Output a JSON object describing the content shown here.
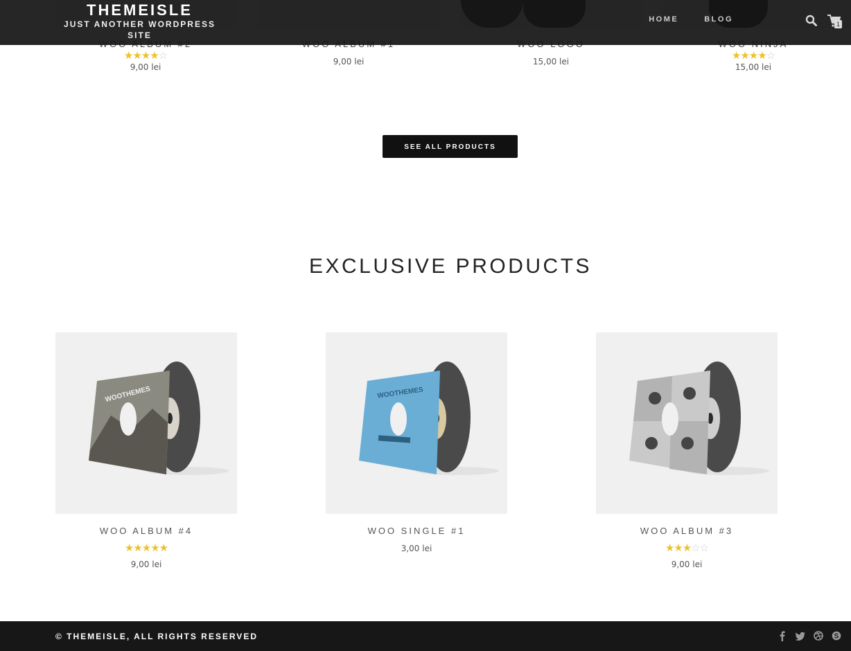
{
  "header": {
    "site_title": "THEMEISLE",
    "tagline": "JUST ANOTHER WORDPRESS SITE",
    "nav": [
      {
        "label": "HOME"
      },
      {
        "label": "BLOG"
      }
    ],
    "cart_count": "1"
  },
  "top_products": [
    {
      "name": "WOO ALBUM #2",
      "rating": 4,
      "price": "9,00 lei"
    },
    {
      "name": "WOO ALBUM #1",
      "rating": 0,
      "price": "9,00 lei"
    },
    {
      "name": "WOO LOGO",
      "rating": 0,
      "price": "15,00 lei"
    },
    {
      "name": "WOO NINJA",
      "rating": 4,
      "price": "15,00 lei"
    }
  ],
  "see_all_button": "SEE ALL PRODUCTS",
  "exclusive": {
    "title": "EXCLUSIVE PRODUCTS",
    "products": [
      {
        "name": "WOO ALBUM #4",
        "rating": 5,
        "price": "9,00 lei",
        "cover_text": "WOOTHEMES"
      },
      {
        "name": "WOO SINGLE #1",
        "rating": 0,
        "price": "3,00 lei",
        "cover_text": "WOOTHEMES"
      },
      {
        "name": "WOO ALBUM #3",
        "rating": 3,
        "price": "9,00 lei",
        "cover_text": ""
      }
    ]
  },
  "footer": {
    "copyright": "© THEMEISLE, ALL RIGHTS RESERVED",
    "social_icons": [
      "facebook-icon",
      "twitter-icon",
      "dribbble-icon",
      "skype-icon"
    ]
  },
  "colors": {
    "header_bg": "#161616",
    "star": "#ecc12a",
    "button_bg": "#111111",
    "footer_bg": "#171717"
  }
}
